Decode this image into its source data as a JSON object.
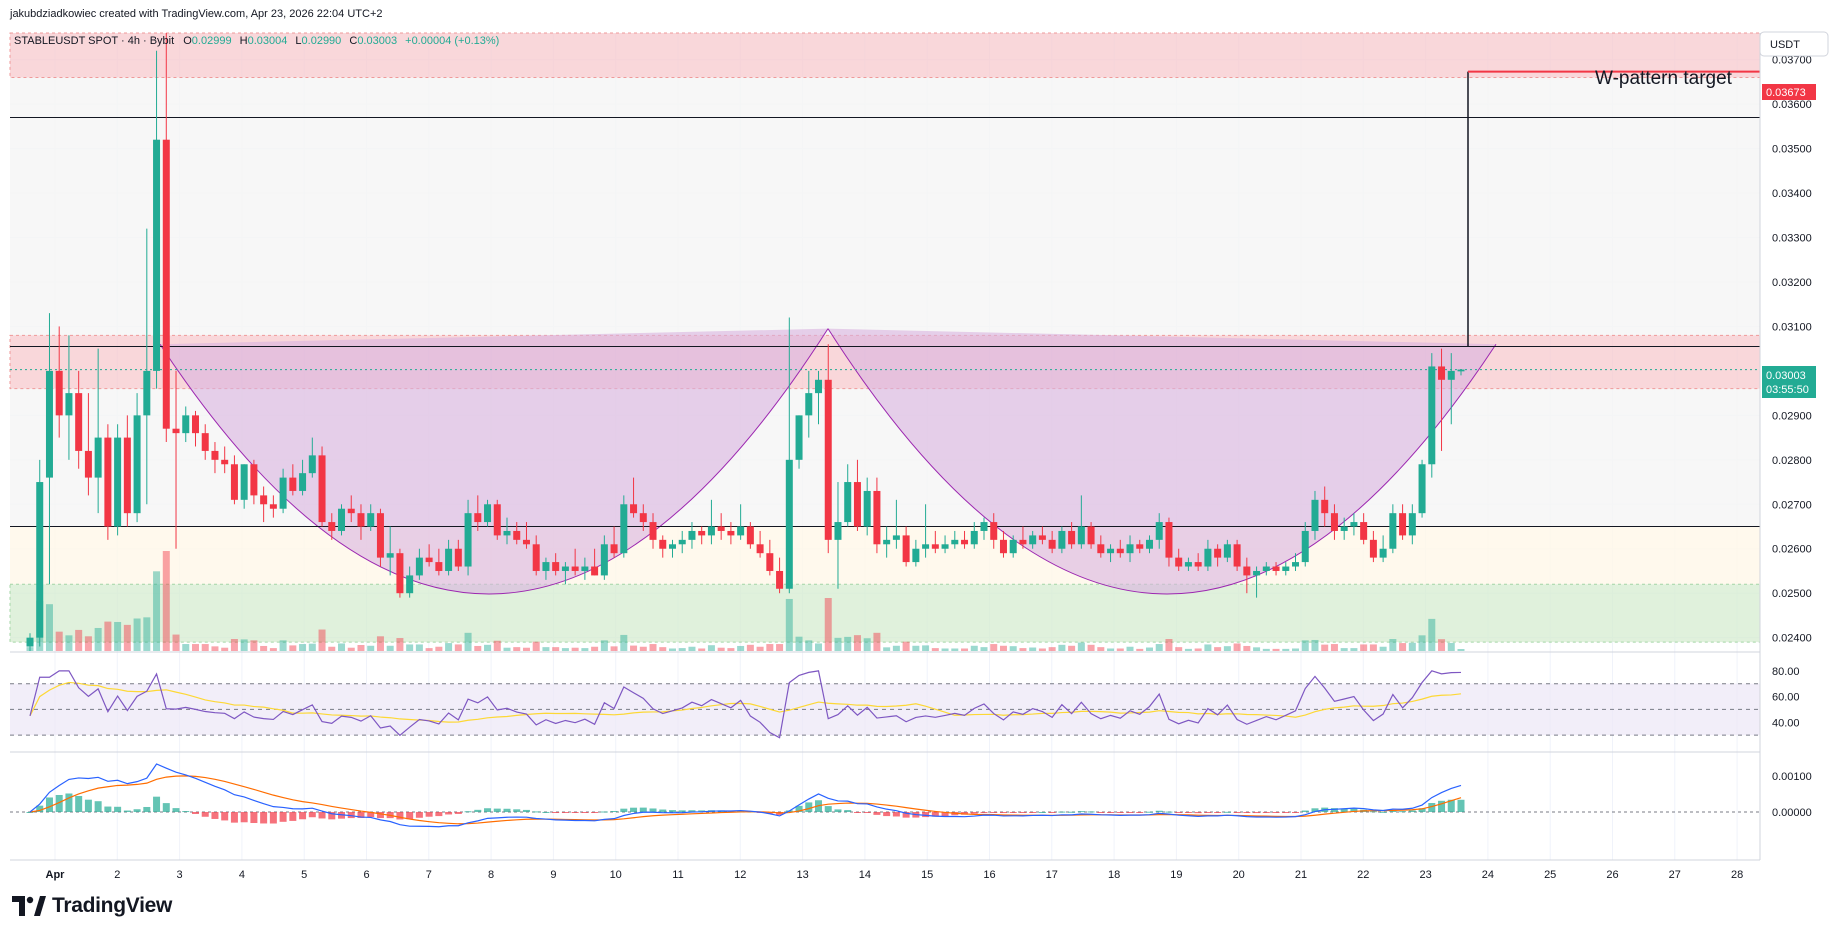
{
  "header": {
    "attribution": "jakubdziadkowiec created with TradingView.com, Apr 23, 2026 22:04 UTC+2"
  },
  "legend": {
    "symbol": "STABLEUSDT SPOT · 4h · Bybit",
    "o_label": "O",
    "o_value": "0.02999",
    "h_label": "H",
    "h_value": "0.03004",
    "l_label": "L",
    "l_value": "0.02990",
    "c_label": "C",
    "c_value": "0.03003",
    "change": "+0.00004 (+0.13%)"
  },
  "price_axis": {
    "currency": "USDT",
    "ticks": [
      "0.03700",
      "0.03600",
      "0.03500",
      "0.03400",
      "0.03300",
      "0.03200",
      "0.03100",
      "0.02900",
      "0.02800",
      "0.02700",
      "0.02600",
      "0.02500",
      "0.02400"
    ],
    "last_price_label": "0.03003",
    "countdown_label": "03:55:50",
    "target_label": "0.03673"
  },
  "rsi_axis": {
    "ticks": [
      "80.00",
      "60.00",
      "40.00"
    ]
  },
  "macd_axis": {
    "ticks": [
      "0.00100",
      "0.00000"
    ]
  },
  "time_axis": {
    "labels": [
      "Apr",
      "2",
      "3",
      "4",
      "5",
      "6",
      "7",
      "8",
      "9",
      "10",
      "11",
      "12",
      "13",
      "14",
      "15",
      "16",
      "17",
      "18",
      "19",
      "20",
      "21",
      "22",
      "23",
      "24",
      "25",
      "26",
      "27",
      "28"
    ]
  },
  "annotation": {
    "target_text": "W-pattern target"
  },
  "brand": {
    "name": "TradingView"
  },
  "colors": {
    "up": "#22ab94",
    "down": "#f23645",
    "accent_blue": "#2962ff",
    "resistance_zone": "#f7c9cd",
    "support_zone": "#d6ecd0",
    "w_pattern_fill": "#d9b3e0",
    "rsi_line": "#7e57c2",
    "rsi_ma": "#fdd835",
    "macd_line": "#2962ff",
    "signal_line": "#ff6d00",
    "target_line": "#f23645"
  },
  "chart_data": {
    "type": "candlestick",
    "timeframe": "4h",
    "y_range": [
      0.0237,
      0.0376
    ],
    "levels": {
      "black_line_top": 0.0357,
      "pattern_neckline": 0.03055,
      "black_line_low": 0.0265,
      "w_pattern_target": 0.03673,
      "last_price": 0.03003
    },
    "zones": [
      {
        "name": "red-top",
        "from": 0.0366,
        "to": 0.0376
      },
      {
        "name": "red-mid",
        "from": 0.0296,
        "to": 0.0308
      },
      {
        "name": "green-low",
        "from": 0.0239,
        "to": 0.0252
      }
    ],
    "w_pattern": {
      "bottom_1": 0.02475,
      "bottom_2": 0.02475,
      "top": 0.0306
    },
    "rsi": {
      "levels": [
        70,
        50,
        30
      ],
      "last": 72
    },
    "candles": [
      {
        "o": 0.0238,
        "h": 0.0241,
        "l": 0.0236,
        "c": 0.024
      },
      {
        "o": 0.024,
        "h": 0.028,
        "l": 0.0238,
        "c": 0.0275
      },
      {
        "o": 0.0276,
        "h": 0.0313,
        "l": 0.0252,
        "c": 0.03
      },
      {
        "o": 0.03,
        "h": 0.031,
        "l": 0.0285,
        "c": 0.029
      },
      {
        "o": 0.029,
        "h": 0.0308,
        "l": 0.028,
        "c": 0.0295
      },
      {
        "o": 0.0295,
        "h": 0.03,
        "l": 0.0278,
        "c": 0.0282
      },
      {
        "o": 0.0282,
        "h": 0.0295,
        "l": 0.0272,
        "c": 0.0276
      },
      {
        "o": 0.0276,
        "h": 0.0305,
        "l": 0.0268,
        "c": 0.0285
      },
      {
        "o": 0.0285,
        "h": 0.0288,
        "l": 0.0262,
        "c": 0.0265
      },
      {
        "o": 0.0265,
        "h": 0.0288,
        "l": 0.0263,
        "c": 0.0285
      },
      {
        "o": 0.0285,
        "h": 0.029,
        "l": 0.0265,
        "c": 0.0268
      },
      {
        "o": 0.0268,
        "h": 0.0295,
        "l": 0.0266,
        "c": 0.029
      },
      {
        "o": 0.029,
        "h": 0.0332,
        "l": 0.027,
        "c": 0.03
      },
      {
        "o": 0.03,
        "h": 0.0372,
        "l": 0.0296,
        "c": 0.0352
      },
      {
        "o": 0.0352,
        "h": 0.038,
        "l": 0.0284,
        "c": 0.0287
      },
      {
        "o": 0.0287,
        "h": 0.03,
        "l": 0.026,
        "c": 0.0286
      },
      {
        "o": 0.0286,
        "h": 0.0292,
        "l": 0.0284,
        "c": 0.029
      },
      {
        "o": 0.029,
        "h": 0.0291,
        "l": 0.0283,
        "c": 0.0286
      },
      {
        "o": 0.0286,
        "h": 0.0288,
        "l": 0.028,
        "c": 0.0282
      },
      {
        "o": 0.0282,
        "h": 0.0284,
        "l": 0.0277,
        "c": 0.028
      },
      {
        "o": 0.028,
        "h": 0.0283,
        "l": 0.0277,
        "c": 0.0279
      },
      {
        "o": 0.0279,
        "h": 0.0281,
        "l": 0.027,
        "c": 0.0271
      },
      {
        "o": 0.0271,
        "h": 0.0279,
        "l": 0.0269,
        "c": 0.0279
      },
      {
        "o": 0.0279,
        "h": 0.028,
        "l": 0.027,
        "c": 0.0272
      },
      {
        "o": 0.0272,
        "h": 0.0274,
        "l": 0.0266,
        "c": 0.027
      },
      {
        "o": 0.027,
        "h": 0.0272,
        "l": 0.0267,
        "c": 0.0269
      },
      {
        "o": 0.0269,
        "h": 0.0278,
        "l": 0.0268,
        "c": 0.0276
      },
      {
        "o": 0.0276,
        "h": 0.0279,
        "l": 0.0272,
        "c": 0.0273
      },
      {
        "o": 0.0273,
        "h": 0.028,
        "l": 0.0272,
        "c": 0.0277
      },
      {
        "o": 0.0277,
        "h": 0.0285,
        "l": 0.0276,
        "c": 0.0281
      },
      {
        "o": 0.0281,
        "h": 0.0283,
        "l": 0.0265,
        "c": 0.0266
      },
      {
        "o": 0.0266,
        "h": 0.0268,
        "l": 0.0262,
        "c": 0.0264
      },
      {
        "o": 0.0264,
        "h": 0.027,
        "l": 0.0263,
        "c": 0.0269
      },
      {
        "o": 0.0269,
        "h": 0.0272,
        "l": 0.0266,
        "c": 0.0268
      },
      {
        "o": 0.0268,
        "h": 0.027,
        "l": 0.0262,
        "c": 0.0265
      },
      {
        "o": 0.0265,
        "h": 0.027,
        "l": 0.0264,
        "c": 0.0268
      },
      {
        "o": 0.0268,
        "h": 0.0269,
        "l": 0.0256,
        "c": 0.0258
      },
      {
        "o": 0.0258,
        "h": 0.0265,
        "l": 0.0254,
        "c": 0.0259
      },
      {
        "o": 0.0259,
        "h": 0.026,
        "l": 0.0249,
        "c": 0.025
      },
      {
        "o": 0.025,
        "h": 0.0256,
        "l": 0.0249,
        "c": 0.0254
      },
      {
        "o": 0.0254,
        "h": 0.026,
        "l": 0.0253,
        "c": 0.0258
      },
      {
        "o": 0.0258,
        "h": 0.0261,
        "l": 0.0256,
        "c": 0.0257
      },
      {
        "o": 0.0257,
        "h": 0.026,
        "l": 0.0254,
        "c": 0.0255
      },
      {
        "o": 0.0255,
        "h": 0.0262,
        "l": 0.0254,
        "c": 0.026
      },
      {
        "o": 0.026,
        "h": 0.0262,
        "l": 0.0255,
        "c": 0.0256
      },
      {
        "o": 0.0256,
        "h": 0.0271,
        "l": 0.0254,
        "c": 0.0268
      },
      {
        "o": 0.0268,
        "h": 0.0272,
        "l": 0.0264,
        "c": 0.0266
      },
      {
        "o": 0.0266,
        "h": 0.0271,
        "l": 0.0265,
        "c": 0.027
      },
      {
        "o": 0.027,
        "h": 0.0271,
        "l": 0.0262,
        "c": 0.0263
      },
      {
        "o": 0.0263,
        "h": 0.0267,
        "l": 0.0261,
        "c": 0.0264
      },
      {
        "o": 0.0264,
        "h": 0.0266,
        "l": 0.0261,
        "c": 0.0262
      },
      {
        "o": 0.0262,
        "h": 0.0266,
        "l": 0.026,
        "c": 0.0261
      },
      {
        "o": 0.0261,
        "h": 0.0263,
        "l": 0.0254,
        "c": 0.0255
      },
      {
        "o": 0.0255,
        "h": 0.0258,
        "l": 0.0253,
        "c": 0.0257
      },
      {
        "o": 0.0257,
        "h": 0.0259,
        "l": 0.0254,
        "c": 0.0255
      },
      {
        "o": 0.0255,
        "h": 0.0257,
        "l": 0.0252,
        "c": 0.0256
      },
      {
        "o": 0.0256,
        "h": 0.026,
        "l": 0.0254,
        "c": 0.0255
      },
      {
        "o": 0.0255,
        "h": 0.0258,
        "l": 0.0253,
        "c": 0.0256
      },
      {
        "o": 0.0256,
        "h": 0.026,
        "l": 0.0254,
        "c": 0.0254
      },
      {
        "o": 0.0254,
        "h": 0.0263,
        "l": 0.0253,
        "c": 0.0261
      },
      {
        "o": 0.0261,
        "h": 0.0265,
        "l": 0.0258,
        "c": 0.0259
      },
      {
        "o": 0.0259,
        "h": 0.0272,
        "l": 0.0258,
        "c": 0.027
      },
      {
        "o": 0.027,
        "h": 0.0276,
        "l": 0.0267,
        "c": 0.0268
      },
      {
        "o": 0.0268,
        "h": 0.027,
        "l": 0.0264,
        "c": 0.0266
      },
      {
        "o": 0.0266,
        "h": 0.0268,
        "l": 0.026,
        "c": 0.0262
      },
      {
        "o": 0.0262,
        "h": 0.0263,
        "l": 0.0258,
        "c": 0.026
      },
      {
        "o": 0.026,
        "h": 0.0262,
        "l": 0.0258,
        "c": 0.0261
      },
      {
        "o": 0.0261,
        "h": 0.0264,
        "l": 0.0259,
        "c": 0.0262
      },
      {
        "o": 0.0262,
        "h": 0.0266,
        "l": 0.026,
        "c": 0.0264
      },
      {
        "o": 0.0264,
        "h": 0.0265,
        "l": 0.0261,
        "c": 0.0263
      },
      {
        "o": 0.0263,
        "h": 0.0271,
        "l": 0.0261,
        "c": 0.0265
      },
      {
        "o": 0.0265,
        "h": 0.0268,
        "l": 0.0262,
        "c": 0.0264
      },
      {
        "o": 0.0264,
        "h": 0.0266,
        "l": 0.0261,
        "c": 0.0263
      },
      {
        "o": 0.0263,
        "h": 0.027,
        "l": 0.0262,
        "c": 0.0265
      },
      {
        "o": 0.0265,
        "h": 0.0266,
        "l": 0.026,
        "c": 0.0261
      },
      {
        "o": 0.0261,
        "h": 0.0264,
        "l": 0.0258,
        "c": 0.0259
      },
      {
        "o": 0.0259,
        "h": 0.0262,
        "l": 0.0254,
        "c": 0.0255
      },
      {
        "o": 0.0255,
        "h": 0.0258,
        "l": 0.025,
        "c": 0.0251
      },
      {
        "o": 0.0251,
        "h": 0.0312,
        "l": 0.025,
        "c": 0.028
      },
      {
        "o": 0.028,
        "h": 0.029,
        "l": 0.0278,
        "c": 0.029
      },
      {
        "o": 0.029,
        "h": 0.03,
        "l": 0.0285,
        "c": 0.0295
      },
      {
        "o": 0.0295,
        "h": 0.03,
        "l": 0.0288,
        "c": 0.0298
      },
      {
        "o": 0.0298,
        "h": 0.0306,
        "l": 0.0259,
        "c": 0.0262
      },
      {
        "o": 0.0262,
        "h": 0.0275,
        "l": 0.0251,
        "c": 0.0266
      },
      {
        "o": 0.0266,
        "h": 0.0279,
        "l": 0.0265,
        "c": 0.0275
      },
      {
        "o": 0.0275,
        "h": 0.028,
        "l": 0.0264,
        "c": 0.0265
      },
      {
        "o": 0.0265,
        "h": 0.0276,
        "l": 0.0263,
        "c": 0.0273
      },
      {
        "o": 0.0273,
        "h": 0.0276,
        "l": 0.0259,
        "c": 0.0261
      },
      {
        "o": 0.0261,
        "h": 0.0265,
        "l": 0.0258,
        "c": 0.0262
      },
      {
        "o": 0.0262,
        "h": 0.0271,
        "l": 0.026,
        "c": 0.0263
      },
      {
        "o": 0.0263,
        "h": 0.0265,
        "l": 0.0256,
        "c": 0.0257
      },
      {
        "o": 0.0257,
        "h": 0.0262,
        "l": 0.0256,
        "c": 0.026
      },
      {
        "o": 0.026,
        "h": 0.027,
        "l": 0.0258,
        "c": 0.0261
      },
      {
        "o": 0.0261,
        "h": 0.0264,
        "l": 0.0259,
        "c": 0.026
      },
      {
        "o": 0.026,
        "h": 0.0263,
        "l": 0.0259,
        "c": 0.0261
      },
      {
        "o": 0.0261,
        "h": 0.0264,
        "l": 0.026,
        "c": 0.0262
      },
      {
        "o": 0.0262,
        "h": 0.0264,
        "l": 0.026,
        "c": 0.0261
      },
      {
        "o": 0.0261,
        "h": 0.0266,
        "l": 0.026,
        "c": 0.0264
      },
      {
        "o": 0.0264,
        "h": 0.0267,
        "l": 0.0262,
        "c": 0.0266
      },
      {
        "o": 0.0266,
        "h": 0.0268,
        "l": 0.026,
        "c": 0.0262
      },
      {
        "o": 0.0262,
        "h": 0.0264,
        "l": 0.0258,
        "c": 0.0259
      },
      {
        "o": 0.0259,
        "h": 0.0263,
        "l": 0.0258,
        "c": 0.0262
      },
      {
        "o": 0.0262,
        "h": 0.0265,
        "l": 0.026,
        "c": 0.0261
      },
      {
        "o": 0.0261,
        "h": 0.0264,
        "l": 0.026,
        "c": 0.0263
      },
      {
        "o": 0.0263,
        "h": 0.0265,
        "l": 0.0261,
        "c": 0.0262
      },
      {
        "o": 0.0262,
        "h": 0.0264,
        "l": 0.0259,
        "c": 0.026
      },
      {
        "o": 0.026,
        "h": 0.0265,
        "l": 0.0259,
        "c": 0.0264
      },
      {
        "o": 0.0264,
        "h": 0.0266,
        "l": 0.026,
        "c": 0.0261
      },
      {
        "o": 0.0261,
        "h": 0.0272,
        "l": 0.026,
        "c": 0.0265
      },
      {
        "o": 0.0265,
        "h": 0.0266,
        "l": 0.026,
        "c": 0.0261
      },
      {
        "o": 0.0261,
        "h": 0.0263,
        "l": 0.0258,
        "c": 0.0259
      },
      {
        "o": 0.0259,
        "h": 0.0261,
        "l": 0.0257,
        "c": 0.026
      },
      {
        "o": 0.026,
        "h": 0.0262,
        "l": 0.0258,
        "c": 0.0259
      },
      {
        "o": 0.0259,
        "h": 0.0263,
        "l": 0.0257,
        "c": 0.0261
      },
      {
        "o": 0.0261,
        "h": 0.0262,
        "l": 0.0259,
        "c": 0.026
      },
      {
        "o": 0.026,
        "h": 0.0263,
        "l": 0.0259,
        "c": 0.0262
      },
      {
        "o": 0.0262,
        "h": 0.0268,
        "l": 0.026,
        "c": 0.0266
      },
      {
        "o": 0.0266,
        "h": 0.0267,
        "l": 0.0256,
        "c": 0.0258
      },
      {
        "o": 0.0258,
        "h": 0.026,
        "l": 0.0255,
        "c": 0.0256
      },
      {
        "o": 0.0256,
        "h": 0.0258,
        "l": 0.0255,
        "c": 0.0257
      },
      {
        "o": 0.0257,
        "h": 0.0259,
        "l": 0.0255,
        "c": 0.0256
      },
      {
        "o": 0.0256,
        "h": 0.0262,
        "l": 0.0255,
        "c": 0.026
      },
      {
        "o": 0.026,
        "h": 0.0261,
        "l": 0.0256,
        "c": 0.0258
      },
      {
        "o": 0.0258,
        "h": 0.0262,
        "l": 0.0257,
        "c": 0.0261
      },
      {
        "o": 0.0261,
        "h": 0.0262,
        "l": 0.0255,
        "c": 0.0256
      },
      {
        "o": 0.0256,
        "h": 0.0258,
        "l": 0.025,
        "c": 0.0254
      },
      {
        "o": 0.0254,
        "h": 0.0256,
        "l": 0.0249,
        "c": 0.0255
      },
      {
        "o": 0.0255,
        "h": 0.0257,
        "l": 0.0254,
        "c": 0.0256
      },
      {
        "o": 0.0256,
        "h": 0.0257,
        "l": 0.0254,
        "c": 0.0255
      },
      {
        "o": 0.0255,
        "h": 0.0257,
        "l": 0.0254,
        "c": 0.0256
      },
      {
        "o": 0.0256,
        "h": 0.0259,
        "l": 0.0255,
        "c": 0.0257
      },
      {
        "o": 0.0257,
        "h": 0.0266,
        "l": 0.0256,
        "c": 0.0264
      },
      {
        "o": 0.0264,
        "h": 0.0273,
        "l": 0.0262,
        "c": 0.0271
      },
      {
        "o": 0.0271,
        "h": 0.0274,
        "l": 0.0265,
        "c": 0.0268
      },
      {
        "o": 0.0268,
        "h": 0.027,
        "l": 0.0262,
        "c": 0.0264
      },
      {
        "o": 0.0264,
        "h": 0.0267,
        "l": 0.0262,
        "c": 0.0265
      },
      {
        "o": 0.0265,
        "h": 0.0268,
        "l": 0.0263,
        "c": 0.0266
      },
      {
        "o": 0.0266,
        "h": 0.0268,
        "l": 0.0261,
        "c": 0.0262
      },
      {
        "o": 0.0262,
        "h": 0.0264,
        "l": 0.0257,
        "c": 0.0258
      },
      {
        "o": 0.0258,
        "h": 0.0263,
        "l": 0.0257,
        "c": 0.026
      },
      {
        "o": 0.026,
        "h": 0.027,
        "l": 0.0259,
        "c": 0.0268
      },
      {
        "o": 0.0268,
        "h": 0.027,
        "l": 0.0262,
        "c": 0.0263
      },
      {
        "o": 0.0263,
        "h": 0.027,
        "l": 0.0261,
        "c": 0.0268
      },
      {
        "o": 0.0268,
        "h": 0.028,
        "l": 0.0267,
        "c": 0.0279
      },
      {
        "o": 0.0279,
        "h": 0.0304,
        "l": 0.0276,
        "c": 0.0301
      },
      {
        "o": 0.0301,
        "h": 0.0305,
        "l": 0.0282,
        "c": 0.0298
      },
      {
        "o": 0.0298,
        "h": 0.0304,
        "l": 0.0288,
        "c": 0.03
      },
      {
        "o": 0.02999,
        "h": 0.03004,
        "l": 0.0299,
        "c": 0.03003
      }
    ]
  }
}
